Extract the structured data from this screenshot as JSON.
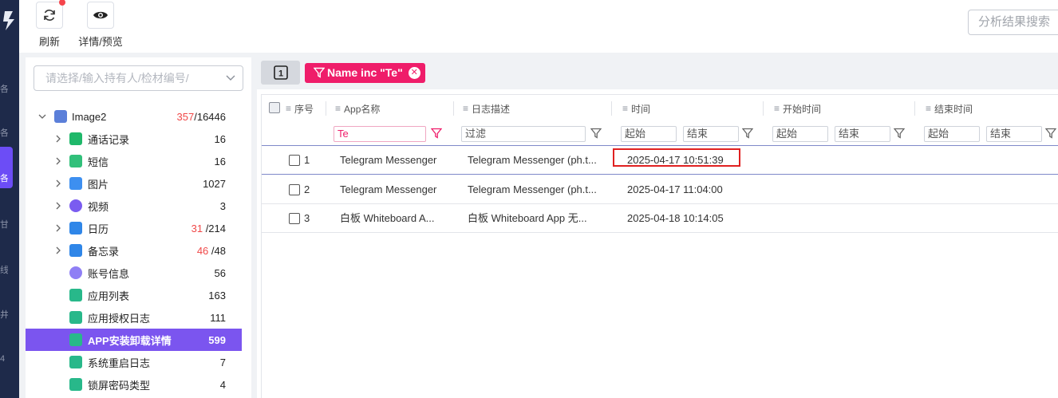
{
  "toolbar": {
    "refresh_label": "刷新",
    "preview_label": "详情/预览",
    "search_results_placeholder": "分析结果搜索"
  },
  "rail": {
    "glyphs": [
      "各",
      "各",
      "各",
      "甘",
      "线",
      "井",
      "4"
    ]
  },
  "left_panel": {
    "case_select_placeholder": "请选择/输入持有人/检材编号/",
    "tree": [
      {
        "name": "Image2",
        "count_red": "357",
        "count": "/16446",
        "icon": "image-file-icon",
        "color": "#5b7fd9",
        "expanded": true
      },
      {
        "name": "通话记录",
        "count": "16",
        "icon": "phone-icon",
        "color": "#1fb86a",
        "arrow": true
      },
      {
        "name": "短信",
        "count": "16",
        "icon": "sms-icon",
        "color": "#31c07a",
        "arrow": true
      },
      {
        "name": "图片",
        "count": "1027",
        "icon": "picture-icon",
        "color": "#3d8ff0",
        "arrow": true
      },
      {
        "name": "视频",
        "count": "3",
        "icon": "video-icon",
        "color": "#7a5cf0",
        "arrow": true
      },
      {
        "name": "日历",
        "count_red": "31",
        "count": "/214",
        "icon": "calendar-icon",
        "color": "#2f86e8",
        "arrow": true
      },
      {
        "name": "备忘录",
        "count_red": "46",
        "count": "/48",
        "icon": "memo-icon",
        "color": "#2f86e8",
        "arrow": true
      },
      {
        "name": "账号信息",
        "count": "56",
        "icon": "account-icon",
        "color": "#8f7ff5"
      },
      {
        "name": "应用列表",
        "count": "163",
        "icon": "list-icon",
        "color": "#28b88a"
      },
      {
        "name": "应用授权日志",
        "count": "111",
        "icon": "list-icon",
        "color": "#28b88a"
      },
      {
        "name": "APP安装卸载详情",
        "count": "599",
        "icon": "list-icon",
        "color": "#28b88a",
        "selected": true
      },
      {
        "name": "系统重启日志",
        "count": "7",
        "icon": "list-icon",
        "color": "#28b88a"
      },
      {
        "name": "锁屏密码类型",
        "count": "4",
        "icon": "list-icon",
        "color": "#28b88a"
      }
    ]
  },
  "filter_bar": {
    "page_button": "1",
    "chip_label": "Name inc \"Te\""
  },
  "table": {
    "headers": [
      "序号",
      "App名称",
      "日志描述",
      "时间",
      "开始时间",
      "结束时间"
    ],
    "filters": {
      "app_name": "Te",
      "description": "过滤",
      "start": "起始",
      "end": "结束"
    },
    "rows": [
      {
        "index": "1",
        "app": "Telegram Messenger",
        "desc": "Telegram Messenger (ph.t...",
        "time": "2025-04-17 10:51:39"
      },
      {
        "index": "2",
        "app": "Telegram Messenger",
        "desc": "Telegram Messenger (ph.t...",
        "time": "2025-04-17 11:04:00"
      },
      {
        "index": "3",
        "app": "白板 Whiteboard A...",
        "desc": "白板 Whiteboard App 无...",
        "time": "2025-04-18 10:14:05"
      }
    ]
  },
  "colors": {
    "accent": "#7b55ef",
    "chip": "#ef1d6a",
    "rail": "#1e2a4a",
    "highlight": "#e02020"
  }
}
